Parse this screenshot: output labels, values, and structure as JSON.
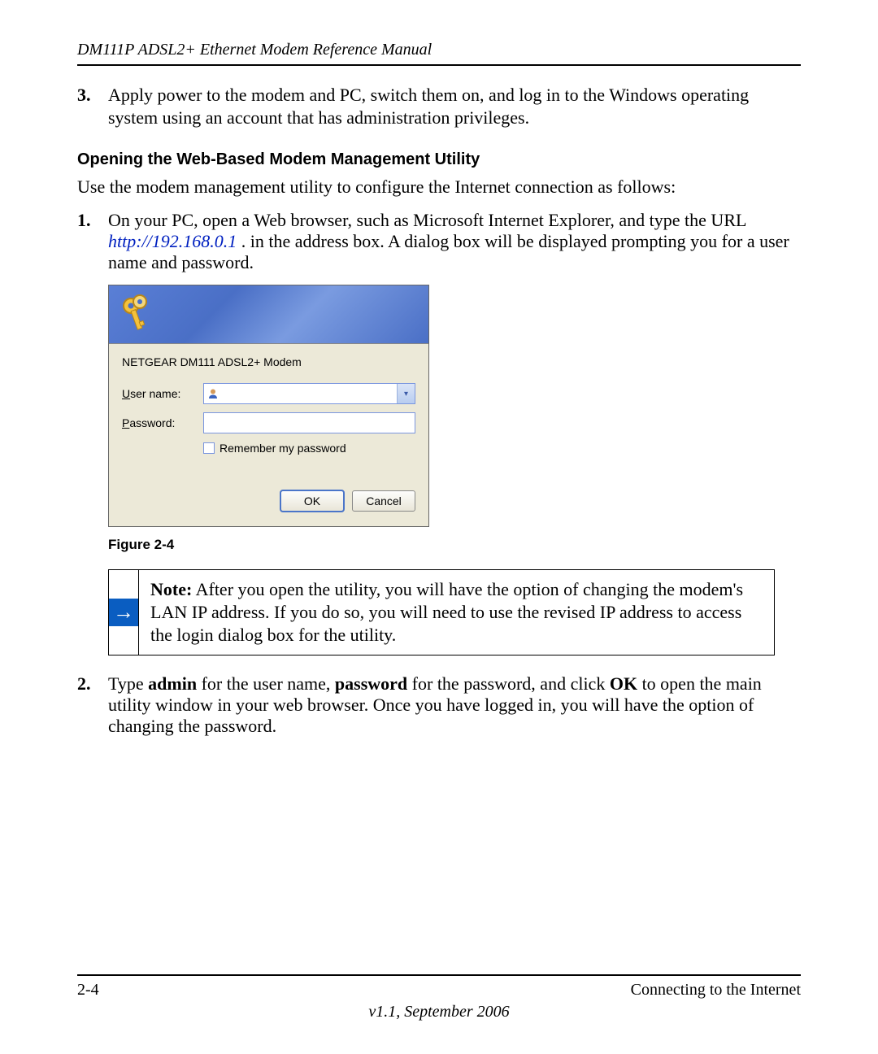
{
  "header": {
    "title": "DM111P ADSL2+ Ethernet Modem Reference Manual"
  },
  "steps_top": {
    "num3": "3.",
    "text3": "Apply power to the modem and PC, switch them on, and log in to the Windows operating system using an account that has administration privileges."
  },
  "section_heading": "Opening the Web-Based Modem Management Utility",
  "intro_para": "Use the modem management utility to configure the Internet connection as follows:",
  "step1": {
    "num": "1.",
    "part_a": "On your PC, open a Web browser, such as Microsoft Internet Explorer, and type the URL ",
    "url": "http://192.168.0.1",
    "part_b": ". in the address box. A dialog box will be displayed prompting you for a user name and password."
  },
  "dialog": {
    "site": "NETGEAR DM111 ADSL2+ Modem",
    "user_label_prefix": "U",
    "user_label_rest": "ser name:",
    "pass_label_prefix": "P",
    "pass_label_rest": "assword:",
    "remember_prefix": "R",
    "remember_rest": "emember my password",
    "ok": "OK",
    "cancel": "Cancel"
  },
  "figure_caption": "Figure 2-4",
  "note": {
    "label": "Note:",
    "text": " After you open the utility, you will have the option of changing the modem's LAN IP address. If you do so, you will need to use the revised IP address to access the login dialog box for the utility."
  },
  "step2": {
    "num": "2.",
    "p1": "Type ",
    "b1": "admin",
    "p2": " for the user name, ",
    "b2": "password",
    "p3": " for the password, and click ",
    "b3": "OK",
    "p4": " to open the main utility window in your web browser. Once you have logged in, you will have the option of changing the password."
  },
  "footer": {
    "page_num": "2-4",
    "section": "Connecting to the Internet",
    "version": "v1.1, September 2006"
  }
}
